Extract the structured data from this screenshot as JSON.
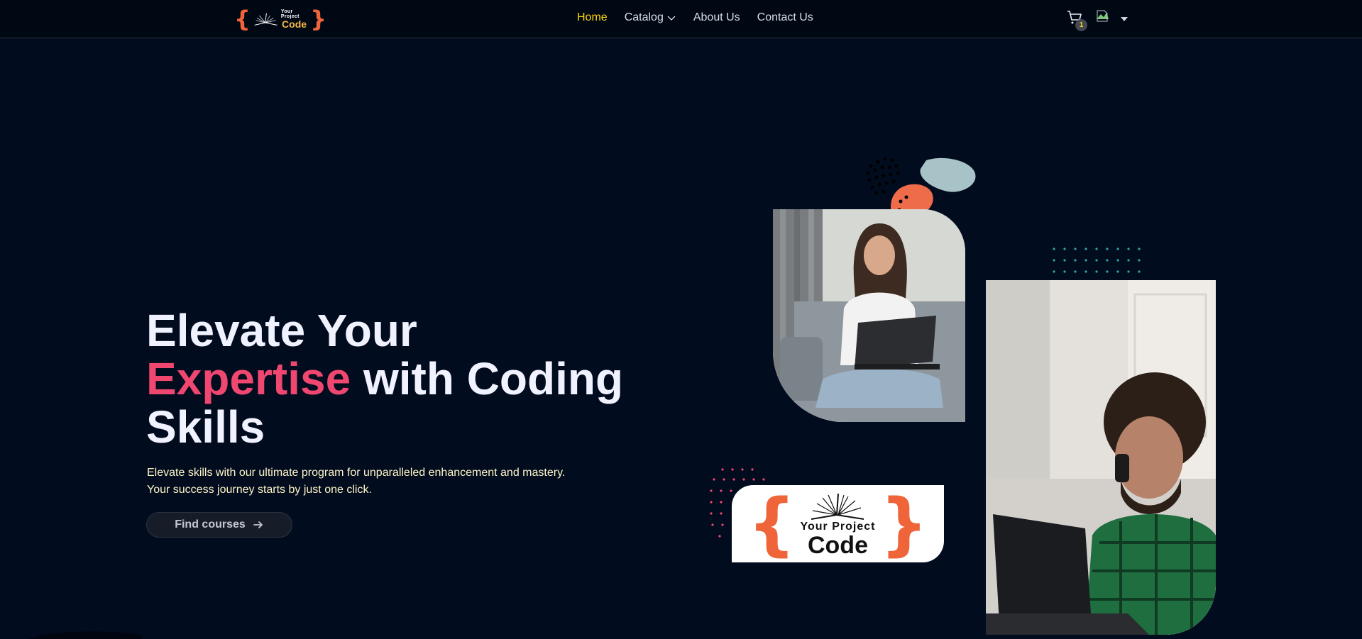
{
  "brand": {
    "logo_small": "Your Project",
    "logo_big": "Code"
  },
  "nav": {
    "items": [
      {
        "label": "Home",
        "active": true
      },
      {
        "label": "Catalog",
        "has_dropdown": true
      },
      {
        "label": "About Us"
      },
      {
        "label": "Contact Us"
      }
    ],
    "cart_count": "1"
  },
  "hero": {
    "title_line1": "Elevate Your",
    "title_accent": "Expertise",
    "title_rest": " with Coding",
    "title_line3": "Skills",
    "desc_line1": "Elevate skills with our ultimate program for unparalleled enhancement and mastery.",
    "desc_line2": "Your success journey starts by just one click.",
    "cta_label": "Find courses"
  },
  "logo_card": {
    "small": "Your Project",
    "big": "Code"
  },
  "colors": {
    "background": "#020c1f",
    "nav_active": "#ffd60a",
    "accent_pink": "#ef476f",
    "brand_orange": "#f0643a",
    "desc_text": "#fff6c8"
  },
  "icons": [
    "cart-icon",
    "avatar-icon",
    "caret-down-icon",
    "chevron-down-icon",
    "arrow-right-icon"
  ]
}
